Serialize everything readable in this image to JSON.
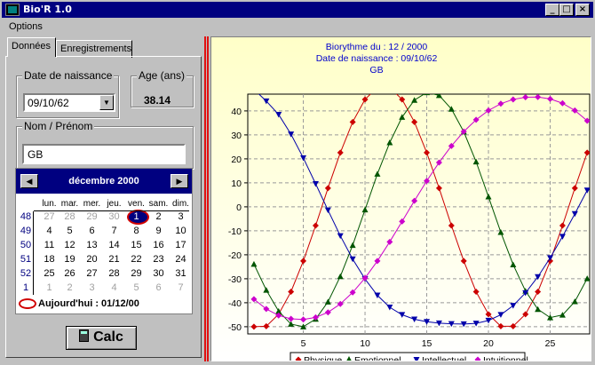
{
  "window": {
    "title": "Bio'R 1.0"
  },
  "menu": {
    "options": "Options"
  },
  "tabs": {
    "donnees": "Données",
    "enregistrements": "Enregistrements"
  },
  "birth": {
    "label": "Date de naissance",
    "value": "09/10/62"
  },
  "age": {
    "label": "Age (ans)",
    "value": "38.14"
  },
  "name": {
    "label": "Nom / Prénom",
    "value": "GB"
  },
  "calendar": {
    "title": "décembre 2000",
    "dow": [
      "lun.",
      "mar.",
      "mer.",
      "jeu.",
      "ven.",
      "sam.",
      "dim."
    ],
    "weeks": [
      {
        "no": "48",
        "days": [
          "27",
          "28",
          "29",
          "30",
          "1",
          "2",
          "3"
        ]
      },
      {
        "no": "49",
        "days": [
          "4",
          "5",
          "6",
          "7",
          "8",
          "9",
          "10"
        ]
      },
      {
        "no": "50",
        "days": [
          "11",
          "12",
          "13",
          "14",
          "15",
          "16",
          "17"
        ]
      },
      {
        "no": "51",
        "days": [
          "18",
          "19",
          "20",
          "21",
          "22",
          "23",
          "24"
        ]
      },
      {
        "no": "52",
        "days": [
          "25",
          "26",
          "27",
          "28",
          "29",
          "30",
          "31"
        ]
      },
      {
        "no": "1",
        "days": [
          "1",
          "2",
          "3",
          "4",
          "5",
          "6",
          "7"
        ]
      }
    ],
    "today_label": "Aujourd'hui : 01/12/00"
  },
  "calc_button": "Calc",
  "chart_data": {
    "type": "line",
    "title_lines": [
      "Biorythme du : 12 / 2000",
      "Date de naissance : 09/10/62",
      "GB"
    ],
    "x": [
      1,
      2,
      3,
      4,
      5,
      6,
      7,
      8,
      9,
      10,
      11,
      12,
      13,
      14,
      15,
      16,
      17,
      18,
      19,
      20,
      21,
      22,
      23,
      24,
      25,
      26,
      27,
      28
    ],
    "xticks": [
      5,
      10,
      15,
      20,
      25
    ],
    "yticks": [
      40,
      30,
      20,
      10,
      0,
      -10,
      -20,
      -30,
      -40,
      -50
    ],
    "xlim": [
      0.5,
      28.2
    ],
    "ylim": [
      -53,
      47
    ],
    "grid": true,
    "legend_position": "bottom",
    "series": [
      {
        "name": "Physique",
        "color": "#cc0000",
        "marker": "diamond",
        "values": [
          -50,
          -49.8,
          -44.8,
          -35.4,
          -22.6,
          -7.8,
          7.8,
          22.6,
          35.4,
          44.8,
          49.8,
          49.8,
          44.8,
          35.4,
          22.6,
          7.8,
          -7.8,
          -22.6,
          -35.4,
          -44.8,
          -49.8,
          -49.8,
          -44.8,
          -35.4,
          -22.6,
          -7.8,
          7.8,
          22.6
        ]
      },
      {
        "name": "Emotionnel",
        "color": "#005500",
        "marker": "triangle",
        "values": [
          -23.9,
          -34.7,
          -43.5,
          -48.9,
          -50,
          -46.8,
          -39.6,
          -29.0,
          -16,
          -1.2,
          13.7,
          26.8,
          37.4,
          44.5,
          47.7,
          46.5,
          40.8,
          31.3,
          18.8,
          4.2,
          -10.6,
          -24.1,
          -35.1,
          -42.7,
          -46.2,
          -45.1,
          -39.5,
          -29.9
        ]
      },
      {
        "name": "Intellectuel",
        "color": "#0000aa",
        "marker": "triangle-down",
        "values": [
          49,
          44.1,
          38.5,
          30.3,
          20.4,
          9.6,
          -1.4,
          -12.1,
          -21.8,
          -30.1,
          -36.9,
          -41.9,
          -45,
          -46.9,
          -47.9,
          -48.5,
          -48.8,
          -48.9,
          -48.6,
          -47.4,
          -45,
          -41.2,
          -35.9,
          -29.2,
          -21.3,
          -12.4,
          -2.9,
          6.9
        ]
      },
      {
        "name": "Intuitionnel",
        "color": "#cc00cc",
        "marker": "diamond",
        "values": [
          -38.5,
          -42.6,
          -45.3,
          -46.7,
          -47,
          -46.1,
          -44,
          -40.5,
          -35.7,
          -29.7,
          -22.6,
          -14.6,
          -6.1,
          2.5,
          10.8,
          18.5,
          25.4,
          31.4,
          36.3,
          40.2,
          43,
          44.8,
          45.7,
          45.8,
          45,
          43.2,
          40.2,
          35.9
        ]
      }
    ]
  }
}
